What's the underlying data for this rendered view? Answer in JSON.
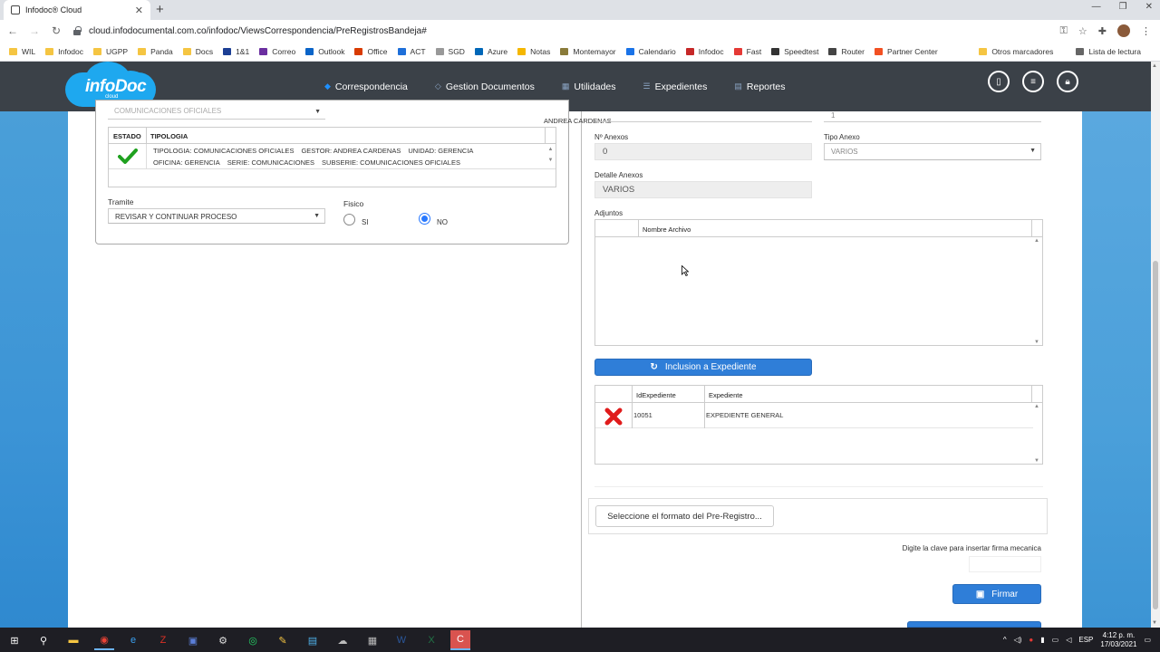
{
  "browser": {
    "tab_title": "Infodoc® Cloud",
    "url": "cloud.infodocumental.com.co/infodoc/ViewsCorrespondencia/PreRegistrosBandeja#",
    "bookmarks": [
      "WIL",
      "Infodoc",
      "UGPP",
      "Panda",
      "Docs",
      "1&1",
      "Correo",
      "Outlook",
      "Office",
      "ACT",
      "SGD",
      "Azure",
      "Notas",
      "Montemayor",
      "Calendario",
      "Infodoc",
      "Fast",
      "Speedtest",
      "Router",
      "Partner Center"
    ],
    "bookmarks_right": [
      "Otros marcadores",
      "Lista de lectura"
    ]
  },
  "header": {
    "logo_text": "infoDoc",
    "logo_sub": "cloud",
    "nav": [
      {
        "label": "Correspondencia",
        "active": true
      },
      {
        "label": "Gestion Documentos",
        "active": false
      },
      {
        "label": "Utilidades",
        "active": false
      },
      {
        "label": "Expedientes",
        "active": false
      },
      {
        "label": "Reportes",
        "active": false
      }
    ]
  },
  "left": {
    "faded_select": "COMUNICACIONES OFICIALES",
    "tipologia_table": {
      "headers": [
        "ESTADO",
        "TIPOLOGIA"
      ],
      "row": {
        "line1": [
          "TIPOLOGIA: COMUNICACIONES OFICIALES",
          "GESTOR: ANDREA CARDENAS",
          "UNIDAD: GERENCIA"
        ],
        "line2": [
          "OFICINA: GERENCIA",
          "SERIE: COMUNICACIONES",
          "SUBSERIE: COMUNICACIONES OFICIALES"
        ]
      }
    },
    "tramite_label": "Tramite",
    "tramite_value": "REVISAR Y CONTINUAR PROCESO",
    "fisico_label": "Fisico",
    "fisico_options": [
      "SI",
      "NO"
    ],
    "fisico_selected": "NO"
  },
  "right": {
    "top_name": "ANDREA CARDENAS",
    "top_value": "1",
    "anexos_label": "Nº Anexos",
    "anexos_value": "0",
    "tipo_anexo_label": "Tipo Anexo",
    "tipo_anexo_value": "VARIOS",
    "detalle_label": "Detalle Anexos",
    "detalle_value": "VARIOS",
    "adjuntos_label": "Adjuntos",
    "adjuntos_header": "Nombre Archivo",
    "inclusion_button": "Inclusion a Expediente",
    "expediente_headers": [
      "IdExpediente",
      "Expediente"
    ],
    "expediente_rows": [
      {
        "id": "10051",
        "name": "EXPEDIENTE GENERAL"
      }
    ],
    "formato_button": "Seleccione el formato del Pre-Registro...",
    "clave_label": "Digite la clave para insertar firma mecanica",
    "firmar_button": "Firmar"
  },
  "taskbar": {
    "lang": "ESP",
    "time": "4:12 p. m.",
    "date": "17/03/2021"
  },
  "colors": {
    "header_bg": "#3b4148",
    "accent": "#2f7ed8",
    "check": "#1fa11f",
    "delete": "#e01b1b"
  }
}
